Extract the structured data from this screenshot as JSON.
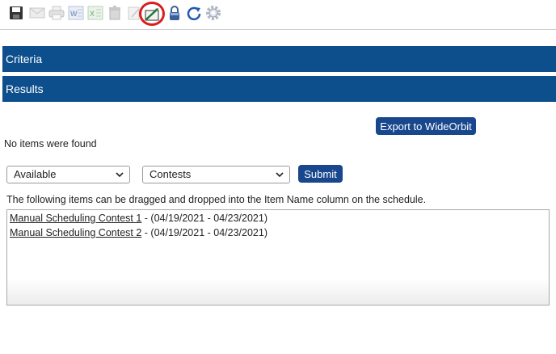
{
  "toolbar": {
    "icons": [
      "save-icon",
      "email-icon",
      "print-icon",
      "export-word-icon",
      "export-excel-icon",
      "delete-icon",
      "edit-icon",
      "schedule-item-icon",
      "lock-icon",
      "refresh-icon",
      "settings-gear-icon"
    ],
    "highlight_color": "#d81e1e"
  },
  "sections": {
    "criteria_label": "Criteria",
    "results_label": "Results"
  },
  "results": {
    "export_button": "Export to WideOrbit",
    "empty_message": "No items were found"
  },
  "filters": {
    "status_select": "Available",
    "type_select": "Contests",
    "submit_button": "Submit"
  },
  "drag_hint": "The following items can be dragged and dropped into the Item Name column on the schedule.",
  "items": [
    {
      "name": "Manual Scheduling Contest 1",
      "dates": " - (04/19/2021 - 04/23/2021)"
    },
    {
      "name": "Manual Scheduling Contest 2",
      "dates": " - (04/19/2021 - 04/23/2021)"
    }
  ],
  "colors": {
    "header_bar": "#0d4f8c",
    "button": "#18478d"
  }
}
